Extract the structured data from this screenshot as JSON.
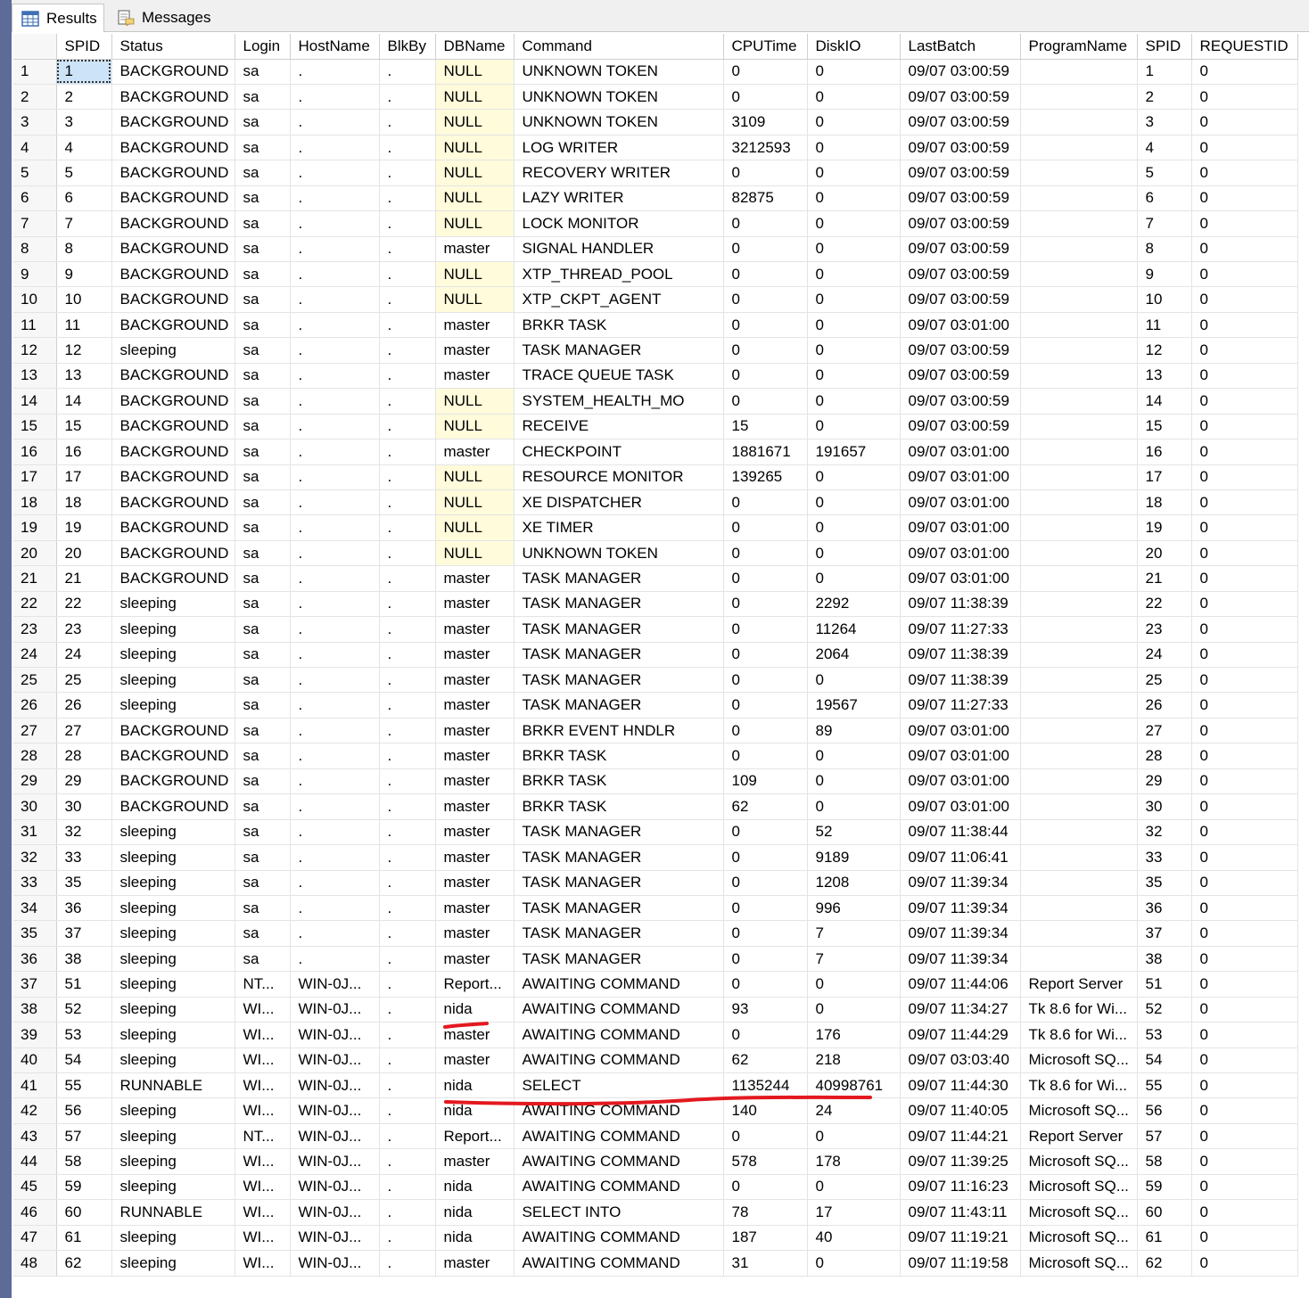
{
  "tabs": [
    {
      "label": "Results",
      "icon": "grid-icon",
      "active": true
    },
    {
      "label": "Messages",
      "icon": "messages-icon",
      "active": false
    }
  ],
  "grid": {
    "columns": [
      "",
      "SPID",
      "Status",
      "Login",
      "HostName",
      "BlkBy",
      "DBName",
      "Command",
      "CPUTime",
      "DiskIO",
      "LastBatch",
      "ProgramName",
      "SPID",
      "REQUESTID"
    ],
    "rows": [
      [
        "1",
        "1",
        "BACKGROUND",
        "sa",
        ".",
        ".",
        "NULL",
        "UNKNOWN TOKEN",
        "0",
        "0",
        "09/07 03:00:59",
        "",
        "1",
        "0"
      ],
      [
        "2",
        "2",
        "BACKGROUND",
        "sa",
        ".",
        ".",
        "NULL",
        "UNKNOWN TOKEN",
        "0",
        "0",
        "09/07 03:00:59",
        "",
        "2",
        "0"
      ],
      [
        "3",
        "3",
        "BACKGROUND",
        "sa",
        ".",
        ".",
        "NULL",
        "UNKNOWN TOKEN",
        "3109",
        "0",
        "09/07 03:00:59",
        "",
        "3",
        "0"
      ],
      [
        "4",
        "4",
        "BACKGROUND",
        "sa",
        ".",
        ".",
        "NULL",
        "LOG WRITER",
        "3212593",
        "0",
        "09/07 03:00:59",
        "",
        "4",
        "0"
      ],
      [
        "5",
        "5",
        "BACKGROUND",
        "sa",
        ".",
        ".",
        "NULL",
        "RECOVERY WRITER",
        "0",
        "0",
        "09/07 03:00:59",
        "",
        "5",
        "0"
      ],
      [
        "6",
        "6",
        "BACKGROUND",
        "sa",
        ".",
        ".",
        "NULL",
        "LAZY WRITER",
        "82875",
        "0",
        "09/07 03:00:59",
        "",
        "6",
        "0"
      ],
      [
        "7",
        "7",
        "BACKGROUND",
        "sa",
        ".",
        ".",
        "NULL",
        "LOCK MONITOR",
        "0",
        "0",
        "09/07 03:00:59",
        "",
        "7",
        "0"
      ],
      [
        "8",
        "8",
        "BACKGROUND",
        "sa",
        ".",
        ".",
        "master",
        "SIGNAL HANDLER",
        "0",
        "0",
        "09/07 03:00:59",
        "",
        "8",
        "0"
      ],
      [
        "9",
        "9",
        "BACKGROUND",
        "sa",
        ".",
        ".",
        "NULL",
        "XTP_THREAD_POOL",
        "0",
        "0",
        "09/07 03:00:59",
        "",
        "9",
        "0"
      ],
      [
        "10",
        "10",
        "BACKGROUND",
        "sa",
        ".",
        ".",
        "NULL",
        "XTP_CKPT_AGENT",
        "0",
        "0",
        "09/07 03:00:59",
        "",
        "10",
        "0"
      ],
      [
        "11",
        "11",
        "BACKGROUND",
        "sa",
        ".",
        ".",
        "master",
        "BRKR TASK",
        "0",
        "0",
        "09/07 03:01:00",
        "",
        "11",
        "0"
      ],
      [
        "12",
        "12",
        "sleeping",
        "sa",
        ".",
        ".",
        "master",
        "TASK MANAGER",
        "0",
        "0",
        "09/07 03:00:59",
        "",
        "12",
        "0"
      ],
      [
        "13",
        "13",
        "BACKGROUND",
        "sa",
        ".",
        ".",
        "master",
        "TRACE QUEUE TASK",
        "0",
        "0",
        "09/07 03:00:59",
        "",
        "13",
        "0"
      ],
      [
        "14",
        "14",
        "BACKGROUND",
        "sa",
        ".",
        ".",
        "NULL",
        "SYSTEM_HEALTH_MO",
        "0",
        "0",
        "09/07 03:00:59",
        "",
        "14",
        "0"
      ],
      [
        "15",
        "15",
        "BACKGROUND",
        "sa",
        ".",
        ".",
        "NULL",
        "RECEIVE",
        "15",
        "0",
        "09/07 03:00:59",
        "",
        "15",
        "0"
      ],
      [
        "16",
        "16",
        "BACKGROUND",
        "sa",
        ".",
        ".",
        "master",
        "CHECKPOINT",
        "1881671",
        "191657",
        "09/07 03:01:00",
        "",
        "16",
        "0"
      ],
      [
        "17",
        "17",
        "BACKGROUND",
        "sa",
        ".",
        ".",
        "NULL",
        "RESOURCE MONITOR",
        "139265",
        "0",
        "09/07 03:01:00",
        "",
        "17",
        "0"
      ],
      [
        "18",
        "18",
        "BACKGROUND",
        "sa",
        ".",
        ".",
        "NULL",
        "XE DISPATCHER",
        "0",
        "0",
        "09/07 03:01:00",
        "",
        "18",
        "0"
      ],
      [
        "19",
        "19",
        "BACKGROUND",
        "sa",
        ".",
        ".",
        "NULL",
        "XE TIMER",
        "0",
        "0",
        "09/07 03:01:00",
        "",
        "19",
        "0"
      ],
      [
        "20",
        "20",
        "BACKGROUND",
        "sa",
        ".",
        ".",
        "NULL",
        "UNKNOWN TOKEN",
        "0",
        "0",
        "09/07 03:01:00",
        "",
        "20",
        "0"
      ],
      [
        "21",
        "21",
        "BACKGROUND",
        "sa",
        ".",
        ".",
        "master",
        "TASK MANAGER",
        "0",
        "0",
        "09/07 03:01:00",
        "",
        "21",
        "0"
      ],
      [
        "22",
        "22",
        "sleeping",
        "sa",
        ".",
        ".",
        "master",
        "TASK MANAGER",
        "0",
        "2292",
        "09/07 11:38:39",
        "",
        "22",
        "0"
      ],
      [
        "23",
        "23",
        "sleeping",
        "sa",
        ".",
        ".",
        "master",
        "TASK MANAGER",
        "0",
        "11264",
        "09/07 11:27:33",
        "",
        "23",
        "0"
      ],
      [
        "24",
        "24",
        "sleeping",
        "sa",
        ".",
        ".",
        "master",
        "TASK MANAGER",
        "0",
        "2064",
        "09/07 11:38:39",
        "",
        "24",
        "0"
      ],
      [
        "25",
        "25",
        "sleeping",
        "sa",
        ".",
        ".",
        "master",
        "TASK MANAGER",
        "0",
        "0",
        "09/07 11:38:39",
        "",
        "25",
        "0"
      ],
      [
        "26",
        "26",
        "sleeping",
        "sa",
        ".",
        ".",
        "master",
        "TASK MANAGER",
        "0",
        "19567",
        "09/07 11:27:33",
        "",
        "26",
        "0"
      ],
      [
        "27",
        "27",
        "BACKGROUND",
        "sa",
        ".",
        ".",
        "master",
        "BRKR EVENT HNDLR",
        "0",
        "89",
        "09/07 03:01:00",
        "",
        "27",
        "0"
      ],
      [
        "28",
        "28",
        "BACKGROUND",
        "sa",
        ".",
        ".",
        "master",
        "BRKR TASK",
        "0",
        "0",
        "09/07 03:01:00",
        "",
        "28",
        "0"
      ],
      [
        "29",
        "29",
        "BACKGROUND",
        "sa",
        ".",
        ".",
        "master",
        "BRKR TASK",
        "109",
        "0",
        "09/07 03:01:00",
        "",
        "29",
        "0"
      ],
      [
        "30",
        "30",
        "BACKGROUND",
        "sa",
        ".",
        ".",
        "master",
        "BRKR TASK",
        "62",
        "0",
        "09/07 03:01:00",
        "",
        "30",
        "0"
      ],
      [
        "31",
        "32",
        "sleeping",
        "sa",
        ".",
        ".",
        "master",
        "TASK MANAGER",
        "0",
        "52",
        "09/07 11:38:44",
        "",
        "32",
        "0"
      ],
      [
        "32",
        "33",
        "sleeping",
        "sa",
        ".",
        ".",
        "master",
        "TASK MANAGER",
        "0",
        "9189",
        "09/07 11:06:41",
        "",
        "33",
        "0"
      ],
      [
        "33",
        "35",
        "sleeping",
        "sa",
        ".",
        ".",
        "master",
        "TASK MANAGER",
        "0",
        "1208",
        "09/07 11:39:34",
        "",
        "35",
        "0"
      ],
      [
        "34",
        "36",
        "sleeping",
        "sa",
        ".",
        ".",
        "master",
        "TASK MANAGER",
        "0",
        "996",
        "09/07 11:39:34",
        "",
        "36",
        "0"
      ],
      [
        "35",
        "37",
        "sleeping",
        "sa",
        ".",
        ".",
        "master",
        "TASK MANAGER",
        "0",
        "7",
        "09/07 11:39:34",
        "",
        "37",
        "0"
      ],
      [
        "36",
        "38",
        "sleeping",
        "sa",
        ".",
        ".",
        "master",
        "TASK MANAGER",
        "0",
        "7",
        "09/07 11:39:34",
        "",
        "38",
        "0"
      ],
      [
        "37",
        "51",
        "sleeping",
        "NT...",
        "WIN-0J...",
        ".",
        "Report...",
        "AWAITING COMMAND",
        "0",
        "0",
        "09/07 11:44:06",
        "Report Server",
        "51",
        "0"
      ],
      [
        "38",
        "52",
        "sleeping",
        "WI...",
        "WIN-0J...",
        ".",
        "nida",
        "AWAITING COMMAND",
        "93",
        "0",
        "09/07 11:34:27",
        "Tk 8.6 for Wi...",
        "52",
        "0"
      ],
      [
        "39",
        "53",
        "sleeping",
        "WI...",
        "WIN-0J...",
        ".",
        "master",
        "AWAITING COMMAND",
        "0",
        "176",
        "09/07 11:44:29",
        "Tk 8.6 for Wi...",
        "53",
        "0"
      ],
      [
        "40",
        "54",
        "sleeping",
        "WI...",
        "WIN-0J...",
        ".",
        "master",
        "AWAITING COMMAND",
        "62",
        "218",
        "09/07 03:03:40",
        "Microsoft SQ...",
        "54",
        "0"
      ],
      [
        "41",
        "55",
        "RUNNABLE",
        "WI...",
        "WIN-0J...",
        ".",
        "nida",
        "SELECT",
        "1135244",
        "40998761",
        "09/07 11:44:30",
        "Tk 8.6 for Wi...",
        "55",
        "0"
      ],
      [
        "42",
        "56",
        "sleeping",
        "WI...",
        "WIN-0J...",
        ".",
        "nida",
        "AWAITING COMMAND",
        "140",
        "24",
        "09/07 11:40:05",
        "Microsoft SQ...",
        "56",
        "0"
      ],
      [
        "43",
        "57",
        "sleeping",
        "NT...",
        "WIN-0J...",
        ".",
        "Report...",
        "AWAITING COMMAND",
        "0",
        "0",
        "09/07 11:44:21",
        "Report Server",
        "57",
        "0"
      ],
      [
        "44",
        "58",
        "sleeping",
        "WI...",
        "WIN-0J...",
        ".",
        "master",
        "AWAITING COMMAND",
        "578",
        "178",
        "09/07 11:39:25",
        "Microsoft SQ...",
        "58",
        "0"
      ],
      [
        "45",
        "59",
        "sleeping",
        "WI...",
        "WIN-0J...",
        ".",
        "nida",
        "AWAITING COMMAND",
        "0",
        "0",
        "09/07 11:16:23",
        "Microsoft SQ...",
        "59",
        "0"
      ],
      [
        "46",
        "60",
        "RUNNABLE",
        "WI...",
        "WIN-0J...",
        ".",
        "nida",
        "SELECT INTO",
        "78",
        "17",
        "09/07 11:43:11",
        "Microsoft SQ...",
        "60",
        "0"
      ],
      [
        "47",
        "61",
        "sleeping",
        "WI...",
        "WIN-0J...",
        ".",
        "nida",
        "AWAITING COMMAND",
        "187",
        "40",
        "09/07 11:19:21",
        "Microsoft SQ...",
        "61",
        "0"
      ],
      [
        "48",
        "62",
        "sleeping",
        "WI...",
        "WIN-0J...",
        ".",
        "master",
        "AWAITING COMMAND",
        "31",
        "0",
        "09/07 11:19:58",
        "Microsoft SQ...",
        "62",
        "0"
      ]
    ]
  },
  "colors": {
    "null_cell_bg": "#fffbdb",
    "selected_cell_bg": "#cde3f7",
    "annotation_red": "#e3191f",
    "window_frame": "#5d6b99"
  }
}
